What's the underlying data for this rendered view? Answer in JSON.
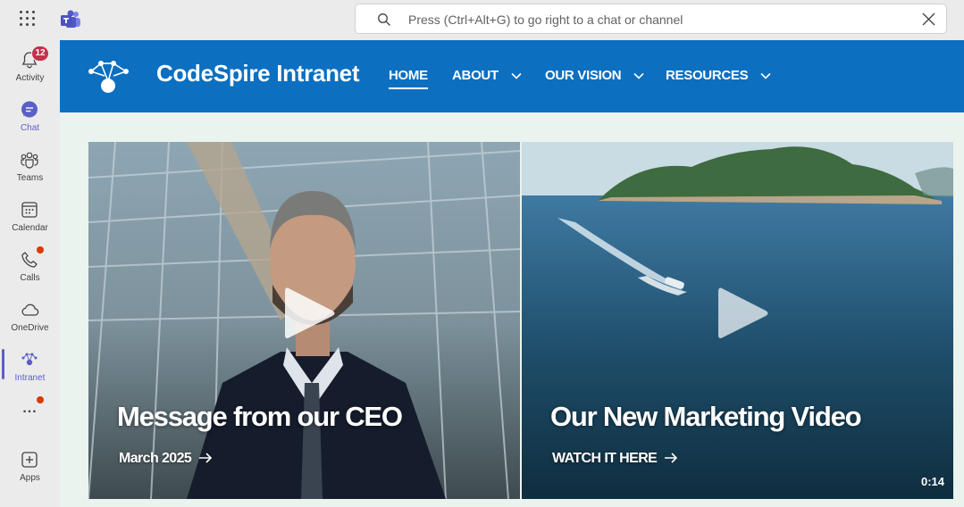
{
  "search": {
    "placeholder": "Press (Ctrl+Alt+G) to go right to a chat or channel"
  },
  "rail": {
    "activity": {
      "label": "Activity",
      "badge": "12"
    },
    "chat": {
      "label": "Chat"
    },
    "teams": {
      "label": "Teams"
    },
    "calendar": {
      "label": "Calendar"
    },
    "calls": {
      "label": "Calls"
    },
    "onedrive": {
      "label": "OneDrive"
    },
    "intranet": {
      "label": "Intranet"
    },
    "more": {
      "label": "..."
    },
    "apps": {
      "label": "Apps"
    }
  },
  "site": {
    "title": "CodeSpire Intranet",
    "nav": [
      {
        "label": "HOME"
      },
      {
        "label": "ABOUT"
      },
      {
        "label": "OUR VISION"
      },
      {
        "label": "RESOURCES"
      }
    ]
  },
  "cards": [
    {
      "title": "Message from our CEO",
      "link": "March 2025"
    },
    {
      "title": "Our New Marketing Video",
      "link": "WATCH IT HERE",
      "duration": "0:14"
    }
  ],
  "colors": {
    "brand_blue": "#0c6fc0",
    "teams_purple": "#5b5fc7",
    "alert_red": "#d83b01",
    "content_bg": "#eaf3ee"
  }
}
